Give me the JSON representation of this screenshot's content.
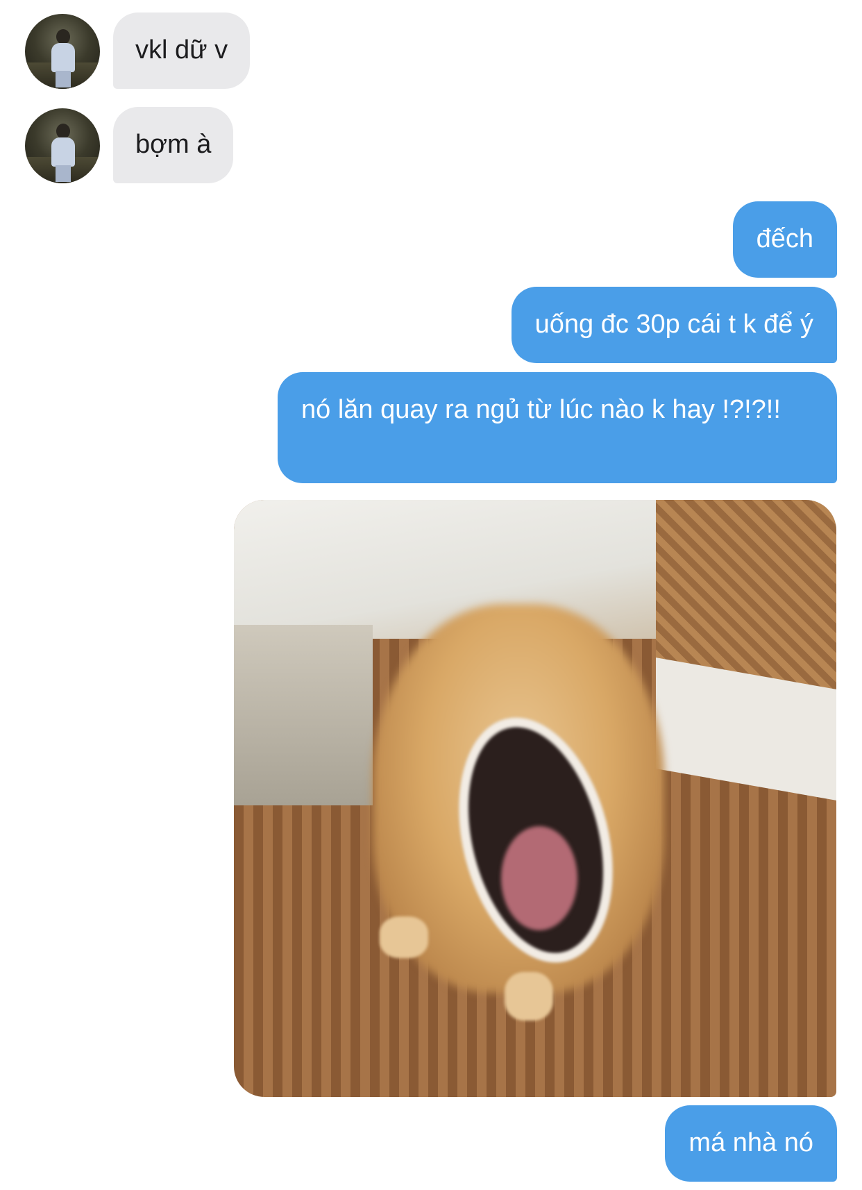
{
  "conversation": {
    "messages": [
      {
        "sender": "other",
        "text": "vkl dữ v"
      },
      {
        "sender": "other",
        "text": "bợm à"
      },
      {
        "sender": "me",
        "text": "đếch"
      },
      {
        "sender": "me",
        "text": "uống đc 30p cái t k để ý"
      },
      {
        "sender": "me",
        "text": "nó lăn quay ra ngủ từ lúc nào k hay !?!?!!"
      },
      {
        "sender": "me",
        "type": "image",
        "image_description": "blurry photo of a shiba dog barking with its mouth open on a bamboo mat"
      },
      {
        "sender": "me",
        "text": "má nhà nó"
      }
    ]
  },
  "colors": {
    "outgoing_bubble": "#4a9ee8",
    "incoming_bubble": "#e9e9eb"
  }
}
